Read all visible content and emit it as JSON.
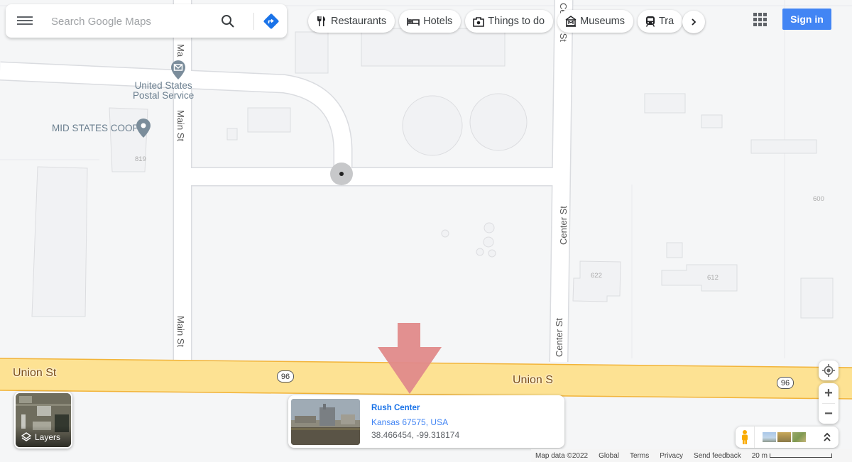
{
  "search": {
    "placeholder": "Search Google Maps",
    "menu_icon": "hamburger-menu-icon",
    "search_icon": "search-icon",
    "directions_icon": "directions-icon"
  },
  "chips": [
    {
      "label": "Restaurants",
      "icon": "restaurant-icon"
    },
    {
      "label": "Hotels",
      "icon": "hotel-icon"
    },
    {
      "label": "Things to do",
      "icon": "camera-icon"
    },
    {
      "label": "Museums",
      "icon": "museum-icon"
    },
    {
      "label": "Tra",
      "icon": "train-icon"
    }
  ],
  "chips_next_icon": "chevron-right-icon",
  "header": {
    "apps_icon": "apps-grid-icon",
    "sign_in": "Sign in"
  },
  "map": {
    "pois": [
      {
        "name": "United States\nPostal Service",
        "line1": "United States",
        "line2": "Postal Service",
        "icon": "mail-pin-icon"
      },
      {
        "name": "MID STATES COOP",
        "icon": "place-pin-icon"
      }
    ],
    "streets": {
      "main_st": "Main St",
      "main_st_top": "Ma",
      "center_st": "Center St",
      "center_st_top": "Center St",
      "union_st": "Union St",
      "union_st_right": "Union S"
    },
    "route_shield": "96",
    "building_numbers": [
      "819",
      "600",
      "622",
      "612"
    ],
    "accent_road_color": "#fde293",
    "marker_arrow_color": "#e08a8a"
  },
  "layers": {
    "label": "Layers",
    "icon": "layers-icon"
  },
  "card": {
    "title": "Rush Center",
    "address": "Kansas 67575, USA",
    "coords": "38.466454, -99.318174",
    "thumb_name": "street-view-thumbnail"
  },
  "controls": {
    "locate_icon": "my-location-icon",
    "zoom_in": "+",
    "zoom_out": "−",
    "pegman_icon": "pegman-icon",
    "expand_icon": "double-chevron-up-icon"
  },
  "footer": {
    "map_data": "Map data ©2022",
    "global": "Global",
    "terms": "Terms",
    "privacy": "Privacy",
    "send_feedback": "Send feedback",
    "scale": "20 m"
  }
}
